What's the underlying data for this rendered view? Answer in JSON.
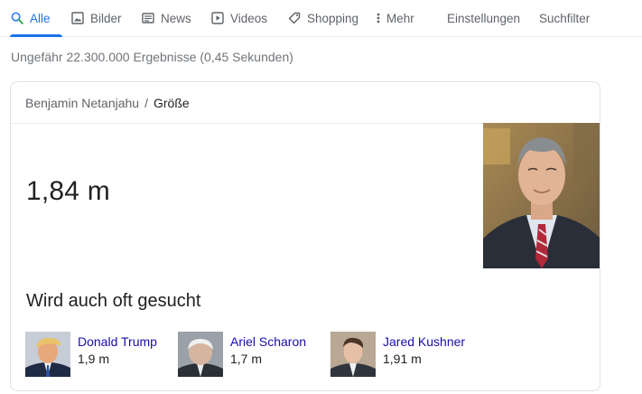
{
  "tabs": [
    {
      "label": "Alle",
      "icon": "search-icon",
      "active": true
    },
    {
      "label": "Bilder",
      "icon": "image-icon"
    },
    {
      "label": "News",
      "icon": "news-icon"
    },
    {
      "label": "Videos",
      "icon": "play-icon"
    },
    {
      "label": "Shopping",
      "icon": "tag-icon"
    },
    {
      "label": "Mehr",
      "icon": "more-vert-icon"
    }
  ],
  "tools": {
    "settings": "Einstellungen",
    "filter": "Suchfilter"
  },
  "stats": "Ungefähr 22.300.000 Ergebnisse (0,45 Sekunden)",
  "card": {
    "breadcrumb": {
      "subject": "Benjamin Netanjahu",
      "separator": "/",
      "attribute": "Größe"
    },
    "answer": "1,84 m",
    "also_title": "Wird auch oft gesucht",
    "people": [
      {
        "name": "Donald Trump",
        "value": "1,9 m"
      },
      {
        "name": "Ariel Scharon",
        "value": "1,7 m"
      },
      {
        "name": "Jared Kushner",
        "value": "1,91 m"
      }
    ]
  },
  "colors": {
    "accent": "#1a73e8",
    "link": "#1a0dab",
    "muted": "#5f6368",
    "border": "#dfe1e5"
  }
}
